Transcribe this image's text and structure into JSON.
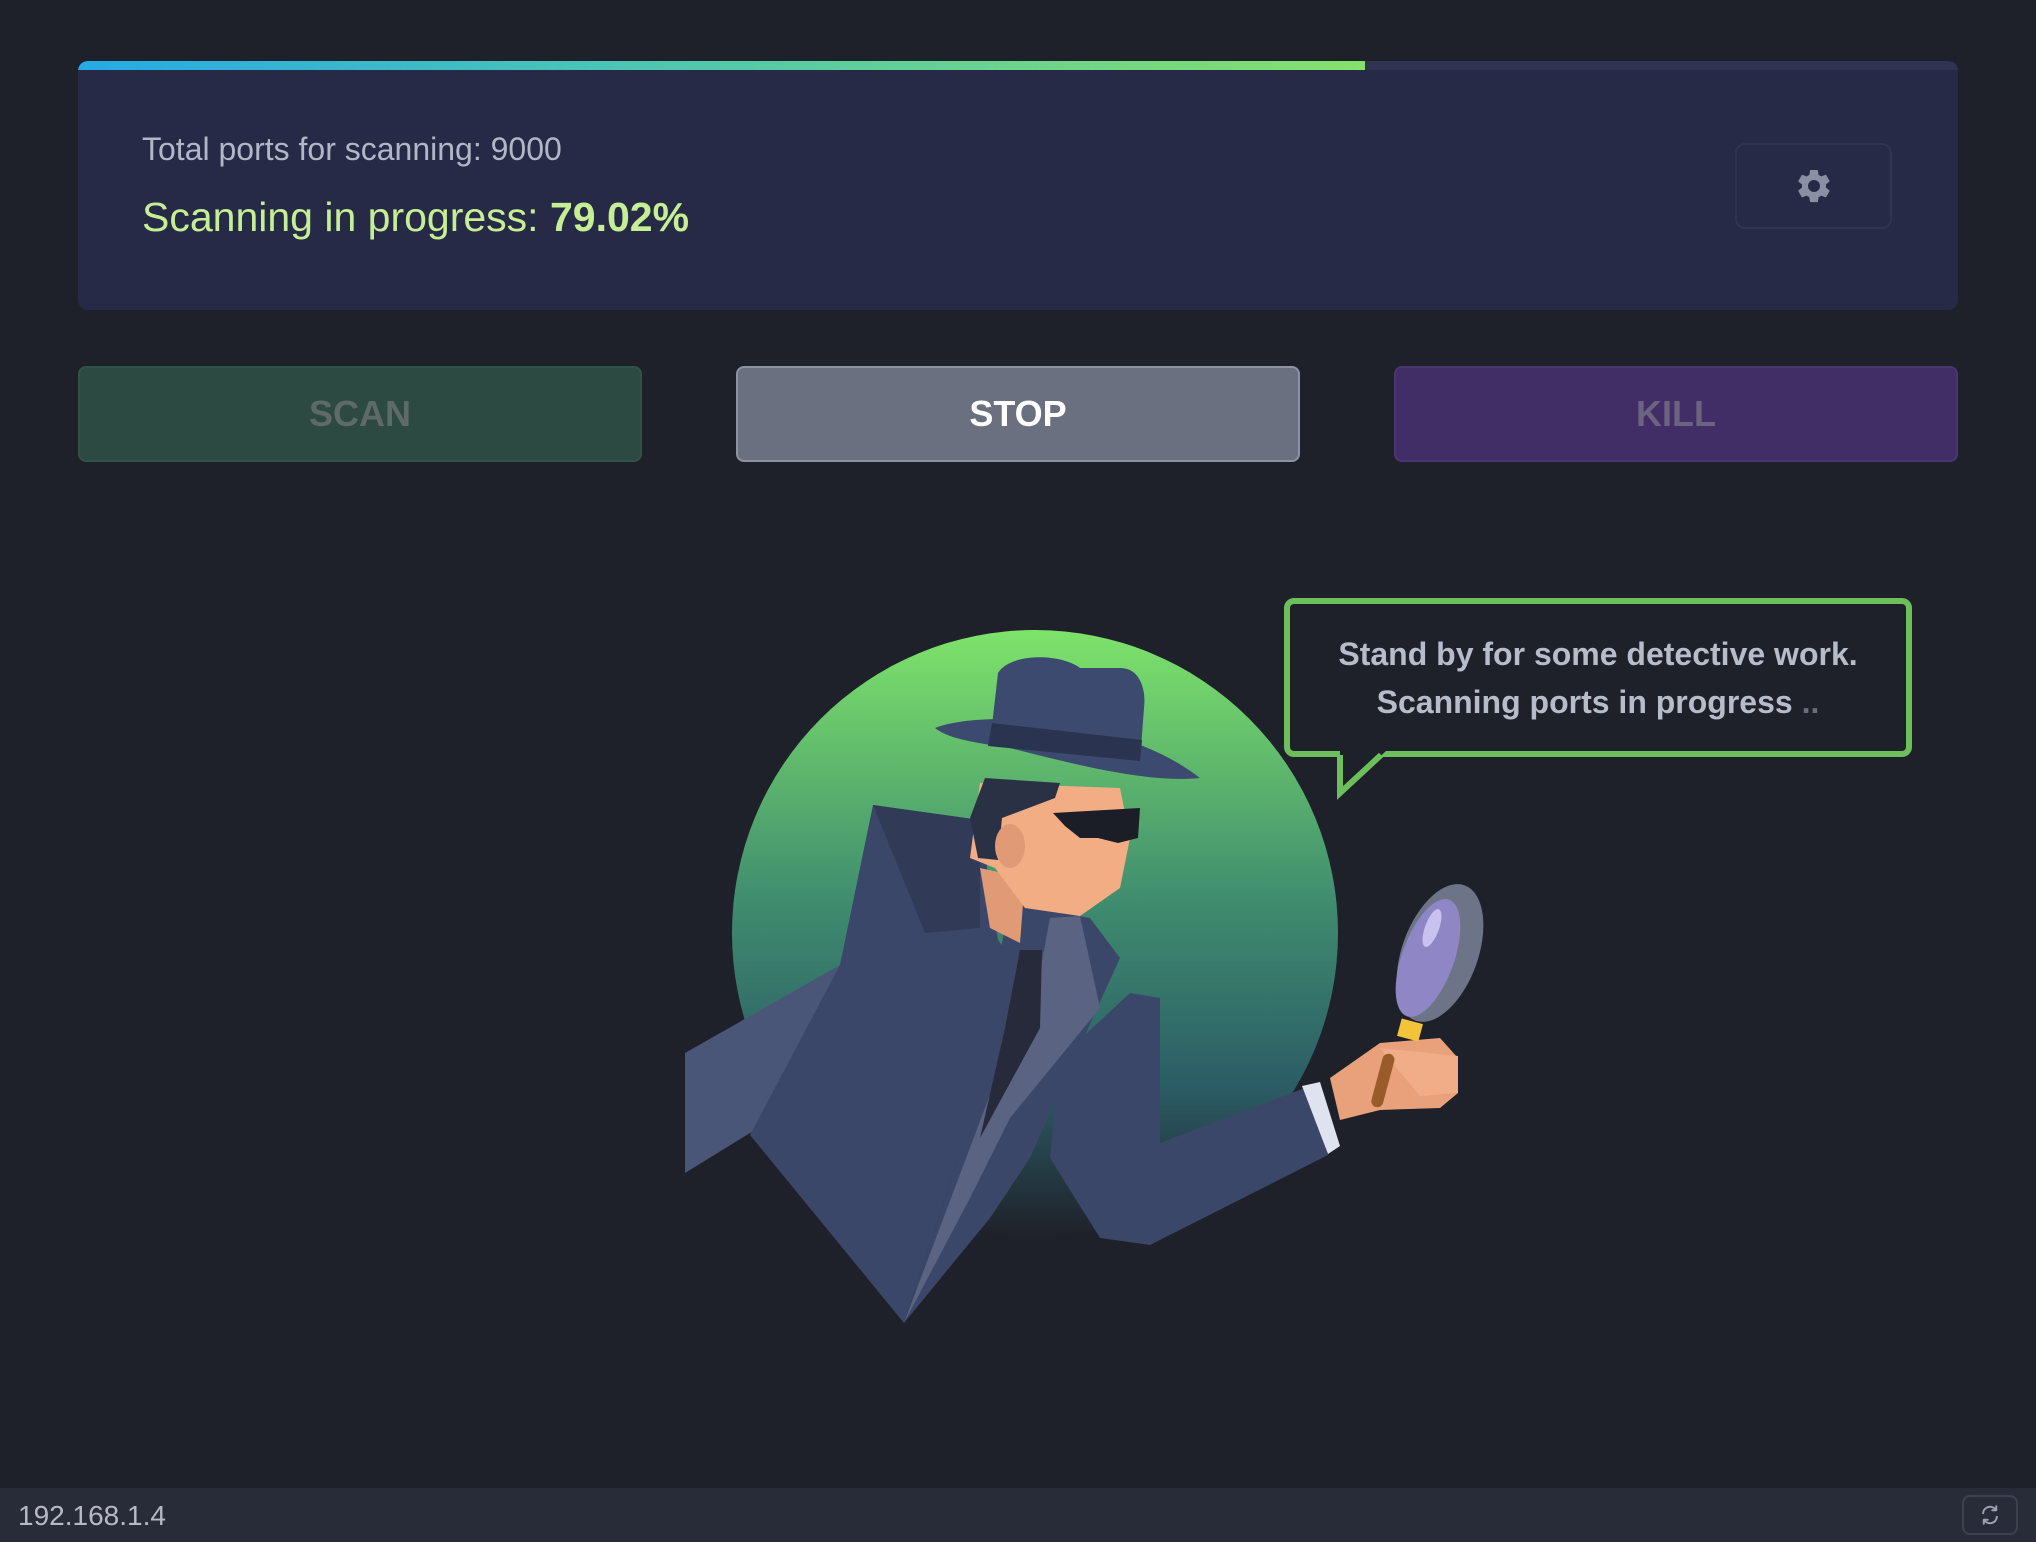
{
  "scan_panel": {
    "progress_fraction": 0.6846,
    "total_ports_label": "Total ports for scanning: 9000",
    "status_prefix": "Scanning in progress: ",
    "status_percent": "79.02%",
    "settings_icon": "gear-icon"
  },
  "actions": {
    "scan_label": "SCAN",
    "stop_label": "STOP",
    "kill_label": "KILL"
  },
  "speech_bubble": {
    "line1": "Stand by for some detective work.",
    "line2": "Scanning ports in progress",
    "dots": " .."
  },
  "footer": {
    "ip_address": "192.168.1.4",
    "refresh_icon": "refresh-icon"
  },
  "colors": {
    "background": "#1f212a",
    "panel": "#262a47",
    "accent_green": "#c6ef95",
    "scan_button": "#2c4a42",
    "stop_button": "#6a7080",
    "kill_button": "#422e67",
    "bubble_border": "#6cbf5a"
  }
}
